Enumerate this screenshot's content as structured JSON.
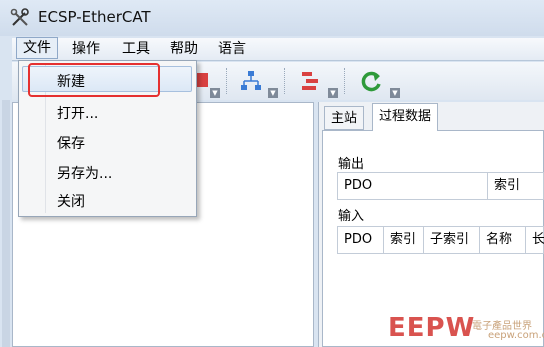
{
  "window": {
    "title": "ECSP-EtherCAT"
  },
  "menu": [
    "文件",
    "操作",
    "工具",
    "帮助",
    "语言"
  ],
  "file_menu": {
    "items": [
      "新建",
      "打开...",
      "保存",
      "另存为...",
      "关闭"
    ]
  },
  "tabs": [
    "主站",
    "过程数据"
  ],
  "process_data": {
    "output_label": "输出",
    "output_columns": [
      "PDO",
      "索引"
    ],
    "input_label": "输入",
    "input_columns": [
      "PDO",
      "索引",
      "子索引",
      "名称",
      "长"
    ]
  },
  "watermark": {
    "logo": "EEPW",
    "cn": "電子產品世界",
    "url": "eepw.com.cn"
  },
  "colors": {
    "highlight_box": "#e53030",
    "tool_red": "#d94141",
    "tool_green": "#2e9a3a",
    "tool_blue": "#3a7bd5"
  },
  "toolbar_icons": [
    "new-icon",
    "network-icon",
    "process-data-icon",
    "refresh-icon"
  ]
}
